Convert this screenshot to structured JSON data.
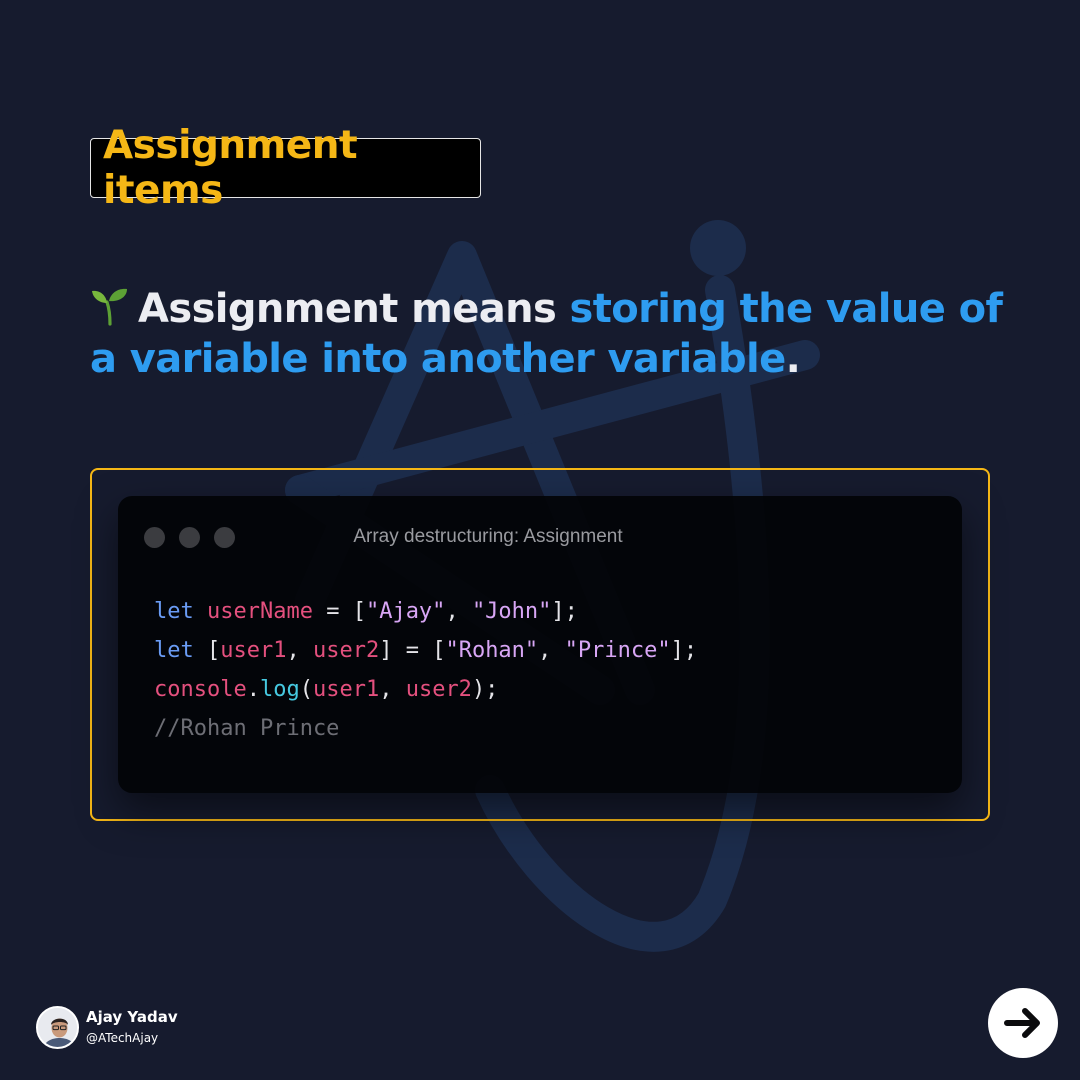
{
  "title": "Assignment items",
  "headline": {
    "emoji_icon": "seedling-icon",
    "part1": "Assignment means ",
    "highlight": "storing the value of a variable into another variable",
    "part2": "."
  },
  "code_window": {
    "title": "Array destructuring: Assignment",
    "lines": [
      [
        {
          "t": "let",
          "c": "kw"
        },
        {
          "t": " "
        },
        {
          "t": "userName",
          "c": "var"
        },
        {
          "t": " = ["
        },
        {
          "t": "\"Ajay\"",
          "c": "str"
        },
        {
          "t": ", "
        },
        {
          "t": "\"John\"",
          "c": "str"
        },
        {
          "t": "];"
        }
      ],
      [
        {
          "t": "let",
          "c": "kw"
        },
        {
          "t": " ["
        },
        {
          "t": "user1",
          "c": "var"
        },
        {
          "t": ", "
        },
        {
          "t": "user2",
          "c": "var"
        },
        {
          "t": "] = ["
        },
        {
          "t": "\"Rohan\"",
          "c": "str"
        },
        {
          "t": ", "
        },
        {
          "t": "\"Prince\"",
          "c": "str"
        },
        {
          "t": "];"
        }
      ],
      [
        {
          "t": "console",
          "c": "var"
        },
        {
          "t": "."
        },
        {
          "t": "log",
          "c": "fn"
        },
        {
          "t": "("
        },
        {
          "t": "user1",
          "c": "var"
        },
        {
          "t": ", "
        },
        {
          "t": "user2",
          "c": "var"
        },
        {
          "t": ");"
        }
      ],
      [
        {
          "t": "//Rohan Prince",
          "c": "cm"
        }
      ]
    ]
  },
  "author": {
    "name": "Ajay Yadav",
    "handle": "@ATechAjay"
  },
  "next_icon": "arrow-right-icon",
  "colors": {
    "background": "#161b2e",
    "accent": "#f5b716",
    "highlight": "#2e9cf0"
  }
}
